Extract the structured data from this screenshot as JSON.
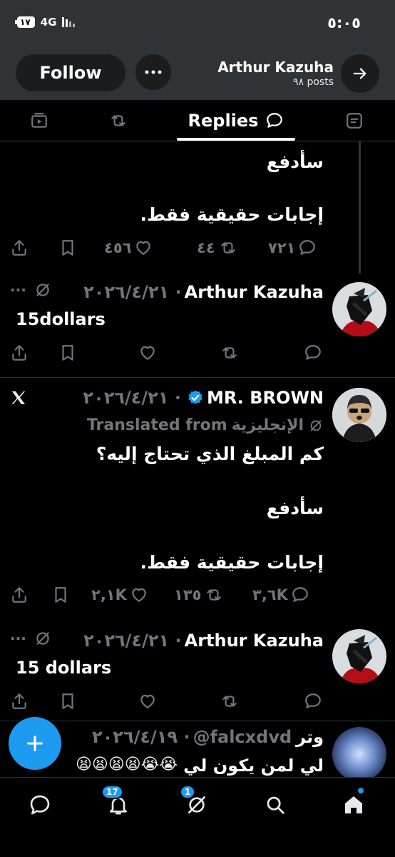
{
  "status_bar": {
    "time": "٥:٠٥",
    "battery": "١٧",
    "network": "4G"
  },
  "header": {
    "follow_label": "Follow",
    "profile_name": "Arthur Kazuha",
    "posts_count": "٩٨ posts"
  },
  "tabs": {
    "active_label": "Replies"
  },
  "tweets": [
    {
      "body_line1": "سأدفع",
      "body_line2": "إجابات حقيقية فقط.",
      "replies": "٧٢١",
      "reposts": "٤٤",
      "likes": "٤٥٦"
    },
    {
      "author": "Arthur Kazuha",
      "date": "٢٠٢٦/٤/٢١ ·",
      "more": "···",
      "body": "15dollars"
    },
    {
      "author": "MR. BROWN",
      "date": "٢٠٢٦/٤/٢١ ·",
      "translated_prefix": "Translated from",
      "translated_lang": "الإنجليزية",
      "body_line1": "كم المبلغ الذي تحتاج إليه؟",
      "body_line2": "سأدفع",
      "body_line3": "إجابات حقيقية فقط.",
      "replies": "٣,٦K",
      "reposts": "١٣٥",
      "likes": "٢,١K"
    },
    {
      "author": "Arthur Kazuha",
      "date": "٢٠٢٦/٤/٢١ ·",
      "more": "···",
      "body": "15 dollars"
    },
    {
      "author": "وتر",
      "handle": "@falcxdvd",
      "date": "٢٠٢٦/٤/١٩ ·",
      "body_partial": "لي لمن يكون لي",
      "emojis": "😭😭😫😫😫😫"
    }
  ],
  "bottom_nav": {
    "notifications_badge": "17",
    "grok_badge": "1"
  },
  "colors": {
    "accent": "#1d9bf0",
    "header_bg": "#2f3336",
    "muted": "#71767b"
  }
}
